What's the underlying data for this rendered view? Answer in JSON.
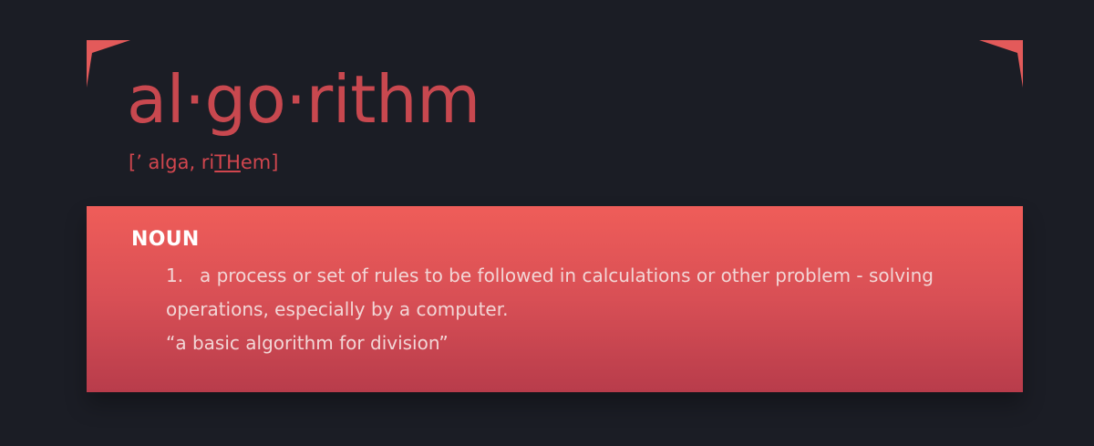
{
  "entry": {
    "word": "al·go·rithm",
    "pronunciation": {
      "before": "[’ alga, ri",
      "underlined": "TH",
      "after": "em]"
    },
    "part_of_speech": "NOUN",
    "senses": [
      {
        "number": "1.",
        "definition": "a process or set of rules to be followed in calculations or other problem - solving operations, especially by a computer.",
        "example": "“a basic algorithm for division”"
      }
    ]
  },
  "colors": {
    "background": "#1b1d25",
    "accent": "#d1464e",
    "panel_top": "#ef5d59",
    "panel_bottom": "#b83c4b",
    "text_light": "#f2d6d6"
  }
}
